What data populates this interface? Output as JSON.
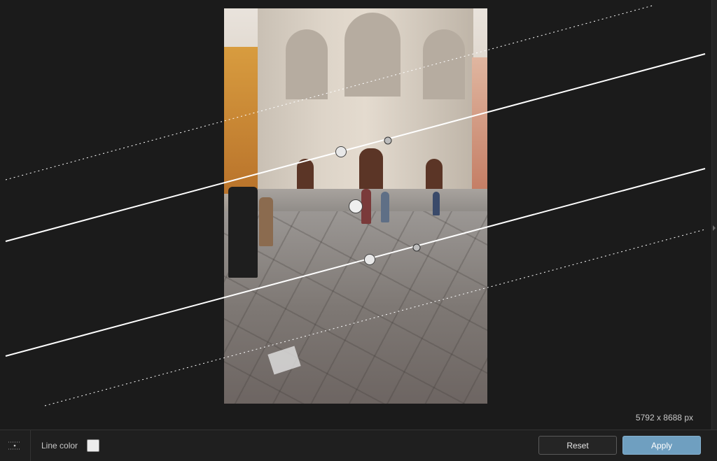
{
  "image_info": {
    "dimensions": "5792 x 8688 px"
  },
  "toolbar": {
    "line_color_label": "Line color",
    "line_color": "#ececec",
    "reset_label": "Reset",
    "apply_label": "Apply"
  },
  "colors": {
    "background": "#1b1b1b",
    "bottombar": "#1f1f1f",
    "apply_button": "#6f9fc0",
    "guide_line": "#ffffff"
  },
  "icons": {
    "grid_toggle": "grid-dots-icon"
  }
}
